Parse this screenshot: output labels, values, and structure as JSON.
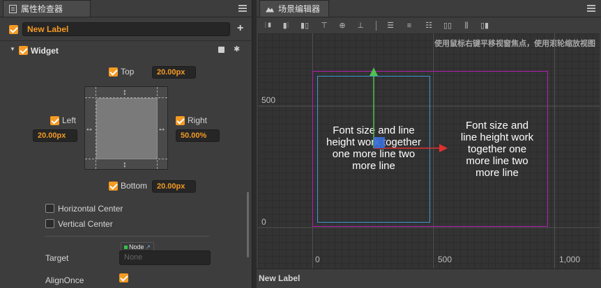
{
  "inspector": {
    "tab_title": "属性检查器",
    "node_name": "New Label",
    "add_button": "+",
    "widget_title": "Widget",
    "top_label": "Top",
    "top_value": "20.00px",
    "left_label": "Left",
    "left_value": "20.00px",
    "right_label": "Right",
    "right_value": "50.00%",
    "bottom_label": "Bottom",
    "bottom_value": "20.00px",
    "horizontal_center": "Horizontal Center",
    "vertical_center": "Vertical Center",
    "target_label": "Target",
    "target_type": "Node",
    "target_value": "None",
    "align_once": "AlignOnce"
  },
  "scene": {
    "tab_title": "场景编辑器",
    "hint": "使用鼠标右键平移视窗焦点，使用滚轮缩放视图",
    "y_tick_500": "500",
    "y_tick_0": "0",
    "x_tick_0": "0",
    "x_tick_500": "500",
    "x_tick_1000": "1,000",
    "label_text_left_lines": [
      "Font size and line",
      "height work together",
      "one more line two",
      "more line"
    ],
    "label_text_right_lines": [
      "Font size and",
      "line height work",
      "together one",
      "more line two",
      "more line"
    ],
    "status_text": "New Label",
    "colors": {
      "accent": "#f59a23",
      "selection_blue": "#3a9ad9",
      "canvas_magenta": "#b41eb4"
    }
  }
}
